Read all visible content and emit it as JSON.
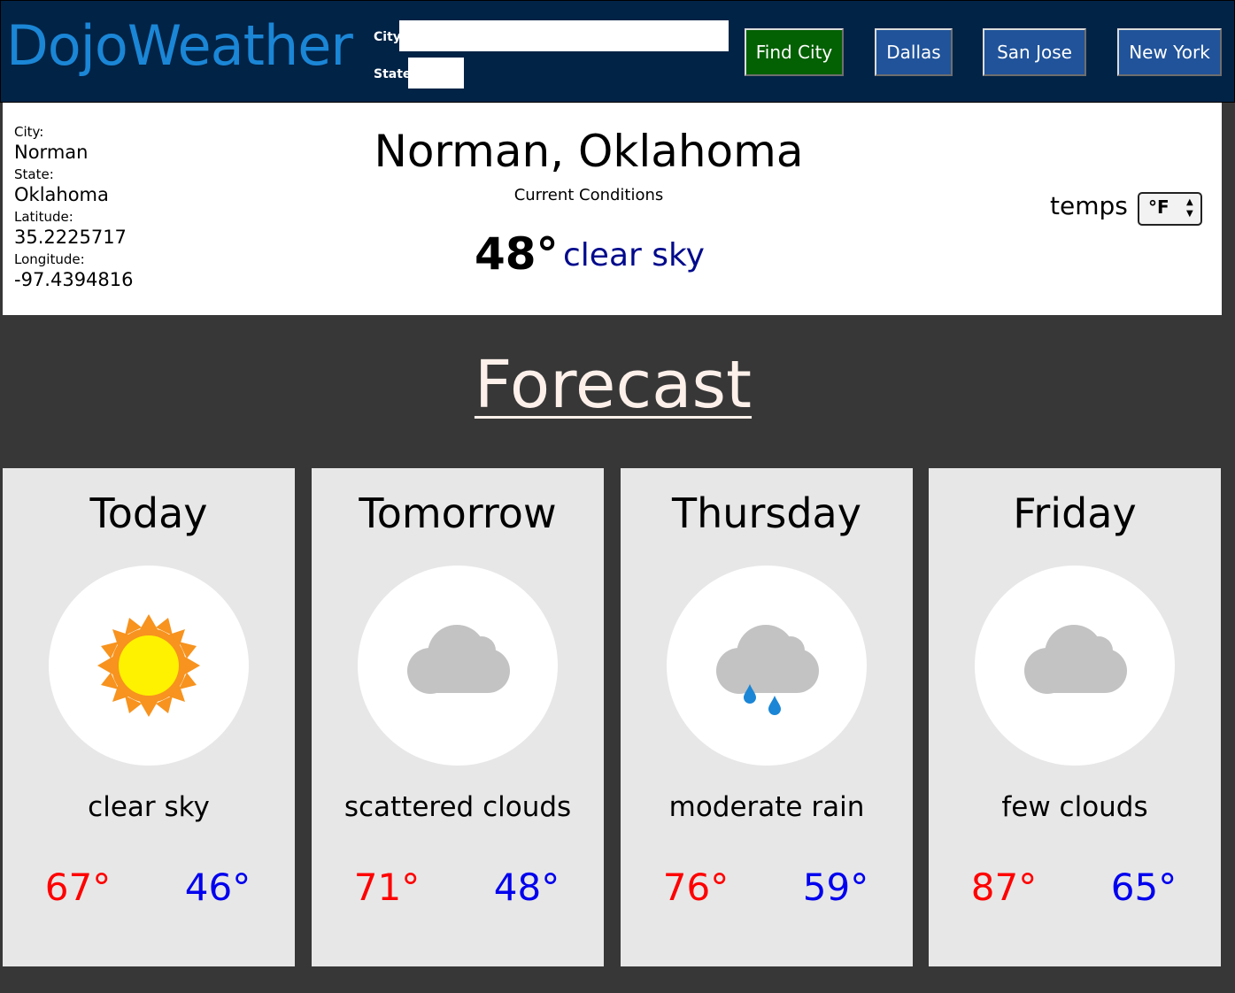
{
  "header": {
    "logo": "DojoWeather",
    "city_label": "City",
    "state_label": "State",
    "city_value": "",
    "state_value": "",
    "find_button": "Find City",
    "quick_cities": [
      "Dallas",
      "San Jose",
      "New York"
    ]
  },
  "current": {
    "city_label": "City:",
    "city": "Norman",
    "state_label": "State:",
    "state": "Oklahoma",
    "latitude_label": "Latitude:",
    "latitude": "35.2225717",
    "longitude_label": "Longitude:",
    "longitude": "-97.4394816",
    "title": "Norman, Oklahoma",
    "conditions_label": "Current Conditions",
    "temp": "48°",
    "description": "clear sky",
    "temps_label": "temps",
    "unit": "°F"
  },
  "forecast": {
    "title": "Forecast",
    "days": [
      {
        "day": "Today",
        "icon": "sun-icon",
        "description": "clear sky",
        "high": "67°",
        "low": "46°"
      },
      {
        "day": "Tomorrow",
        "icon": "cloud-icon",
        "description": "scattered clouds",
        "high": "71°",
        "low": "48°"
      },
      {
        "day": "Thursday",
        "icon": "rain-cloud-icon",
        "description": "moderate rain",
        "high": "76°",
        "low": "59°"
      },
      {
        "day": "Friday",
        "icon": "cloud-icon",
        "description": "few clouds",
        "high": "87°",
        "low": "65°"
      }
    ]
  },
  "colors": {
    "header_bg": "#012346",
    "logo": "#1b86d6",
    "find_button": "#036003",
    "city_button": "#20539a",
    "page_bg": "#373737",
    "card_bg": "#e7e7e7",
    "high_temp": "#ff0000",
    "low_temp": "#0000ee",
    "current_desc": "#000a8c"
  }
}
